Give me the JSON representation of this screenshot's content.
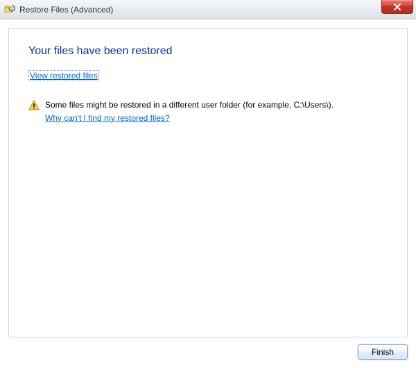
{
  "titlebar": {
    "title": "Restore Files (Advanced)",
    "icon": "restore-files-icon",
    "close_label": "Close"
  },
  "content": {
    "heading": "Your files have been restored",
    "view_link": "View restored files",
    "warning": {
      "icon": "warning-icon",
      "message": "Some files might be restored in a different user folder (for example, C:\\Users\\).",
      "help_link": "Why can't I find my restored files?"
    }
  },
  "buttons": {
    "finish": "Finish"
  }
}
